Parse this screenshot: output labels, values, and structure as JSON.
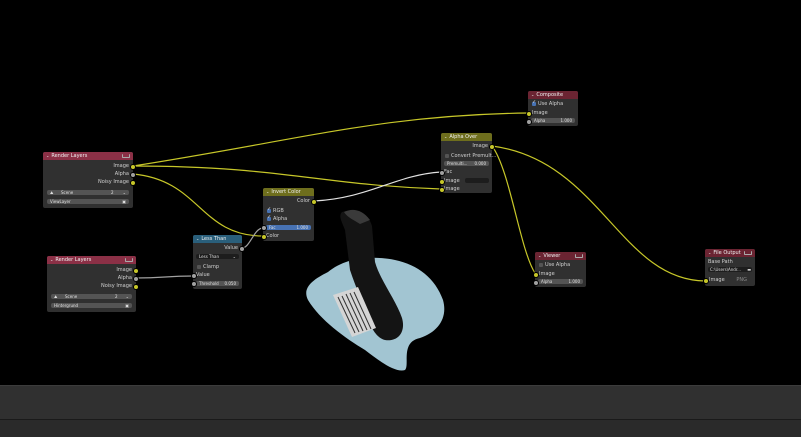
{
  "node_editor": {
    "nodes": {
      "render_layers_1": {
        "title": "Render Layers",
        "outputs": [
          "Image",
          "Alpha",
          "Noisy Image"
        ],
        "scene": {
          "value": "Scene",
          "users": "2"
        },
        "layer": "ViewLayer"
      },
      "render_layers_2": {
        "title": "Render Layers",
        "outputs": [
          "Image",
          "Alpha",
          "Noisy Image"
        ],
        "scene": {
          "value": "Scene",
          "users": "2"
        },
        "layer": "Hintergrund"
      },
      "less_than": {
        "title": "Less Than",
        "output": "Value",
        "operation": "Less Than",
        "clamp_label": "Clamp",
        "input_value": "Value",
        "threshold": {
          "label": "Threshold",
          "value": "0.050"
        }
      },
      "invert_color": {
        "title": "Invert Color",
        "output": "Color",
        "rgb_label": "RGB",
        "alpha_label": "Alpha",
        "fac": {
          "label": "Fac",
          "value": "1.000"
        },
        "input_color": "Color"
      },
      "alpha_over": {
        "title": "Alpha Over",
        "output": "Image",
        "convert_label": "Convert Premult...",
        "premult": {
          "label": "Premulti...",
          "value": "0.000"
        },
        "inputs": [
          "Fac",
          "Image",
          "Image"
        ]
      },
      "composite": {
        "title": "Composite",
        "use_alpha_label": "Use Alpha",
        "input_image": "Image",
        "alpha": {
          "label": "Alpha",
          "value": "1.000"
        }
      },
      "viewer": {
        "title": "Viewer",
        "use_alpha_label": "Use Alpha",
        "input_image": "Image",
        "alpha": {
          "label": "Alpha",
          "value": "1.000"
        }
      },
      "file_output": {
        "title": "File Output",
        "base_path_label": "Base Path",
        "base_path": "C:\\Users\\Andr...",
        "input_image": "Image",
        "format": "PNG"
      }
    },
    "colors": {
      "background": "#000000",
      "node_body": "#303030",
      "render_header": "#8b3046",
      "math_header": "#2a5f7b",
      "color_header": "#6e6e1d",
      "output_header": "#6b2432",
      "image_socket": "#c7c729",
      "value_socket": "#a1a1a1",
      "accent_blue": "#4772b3"
    }
  }
}
